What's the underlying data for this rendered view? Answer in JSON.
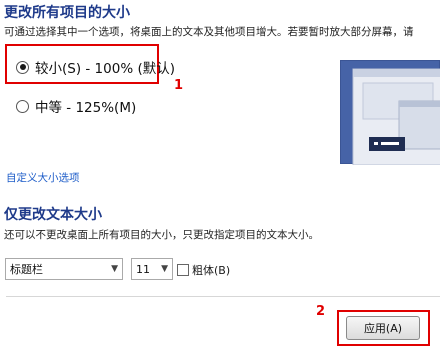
{
  "header": {
    "title": "更改所有项目的大小",
    "description": "可通过选择其中一个选项，将桌面上的文本及其他项目增大。若要暂时放大部分屏幕，请"
  },
  "size_options": [
    {
      "label": "较小(S) - 100% (默认)",
      "selected": true
    },
    {
      "label": "中等 - 125%(M)",
      "selected": false
    }
  ],
  "annotations": {
    "step1": "1",
    "step2": "2",
    "highlight_color": "#e00000"
  },
  "custom_link": "自定义大小选项",
  "text_section": {
    "title": "仅更改文本大小",
    "description": "还可以不更改桌面上所有项目的大小，只更改指定项目的文本大小。"
  },
  "text_controls": {
    "item_select_value": "标题栏",
    "size_select_value": "11",
    "bold_label": "粗体(B)",
    "bold_checked": false,
    "dropdown_icon": "chevron-down-icon"
  },
  "actions": {
    "apply_label": "应用(A)"
  },
  "colors": {
    "title": "#1e3a8a",
    "link": "#1d5cc8",
    "preview_bg": "#4663a7"
  }
}
